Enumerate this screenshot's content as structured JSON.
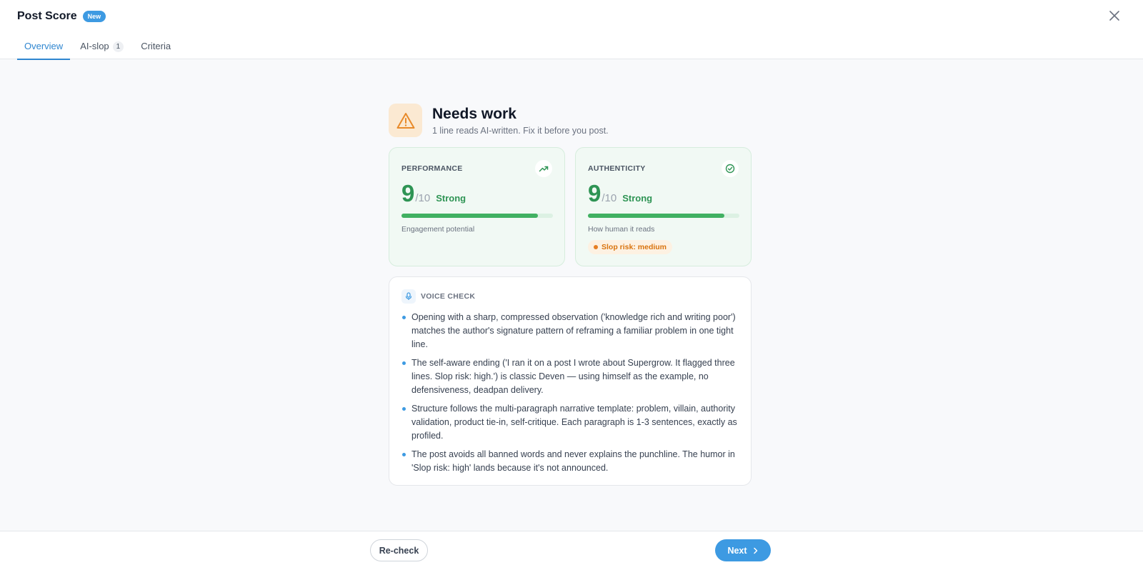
{
  "header": {
    "title": "Post Score",
    "badge": "New"
  },
  "tabs": [
    {
      "label": "Overview",
      "active": true
    },
    {
      "label": "AI-slop",
      "count": "1"
    },
    {
      "label": "Criteria"
    }
  ],
  "verdict": {
    "title": "Needs work",
    "subtitle": "1 line reads AI-written. Fix it before you post.",
    "icon": "warning-triangle-icon"
  },
  "performance": {
    "label": "PERFORMANCE",
    "score": "9",
    "max": "/10",
    "rating": "Strong",
    "progress": 0.9,
    "caption": "Engagement potential",
    "icon": "trending-up-icon"
  },
  "authenticity": {
    "label": "AUTHENTICITY",
    "score": "9",
    "max": "/10",
    "rating": "Strong",
    "progress": 0.9,
    "caption": "How human it reads",
    "risk": "Slop risk: medium",
    "icon": "check-circle-icon"
  },
  "voice_check": {
    "title": "VOICE CHECK",
    "icon": "microphone-icon",
    "items": [
      "Opening with a sharp, compressed observation ('knowledge rich and writing poor') matches the author's signature pattern of reframing a familiar problem in one tight line.",
      "The self-aware ending ('I ran it on a post I wrote about Supergrow. It flagged three lines. Slop risk: high.') is classic Deven — using himself as the example, no defensiveness, deadpan delivery.",
      "Structure follows the multi-paragraph narrative template: problem, villain, authority validation, product tie-in, self-critique. Each paragraph is 1-3 sentences, exactly as profiled.",
      "The post avoids all banned words and never explains the punchline. The humor in 'Slop risk: high' lands because it's not announced."
    ]
  },
  "footer": {
    "recheck_label": "Re-check",
    "next_label": "Next"
  },
  "colors": {
    "accent": "#3d9ae2",
    "success": "#2e9454",
    "warning": "#d9730d"
  }
}
